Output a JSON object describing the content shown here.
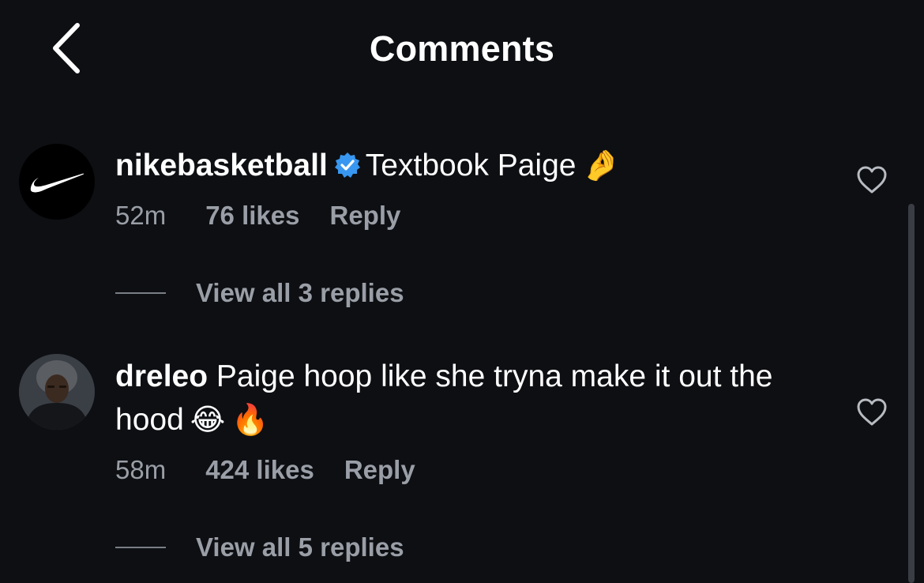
{
  "header": {
    "title": "Comments"
  },
  "comments": [
    {
      "username": "nikebasketball",
      "verified": true,
      "text": "Textbook Paige",
      "emojis": [
        "🤌"
      ],
      "time": "52m",
      "likes": "76 likes",
      "reply": "Reply",
      "view_replies": "View all 3 replies",
      "avatar": "nike-swoosh-logo"
    },
    {
      "username": "dreleo",
      "verified": false,
      "text": "Paige hoop like she tryna make it out the hood",
      "emojis": [
        "😂",
        "🔥"
      ],
      "time": "58m",
      "likes": "424 likes",
      "reply": "Reply",
      "view_replies": "View all 5 replies",
      "avatar": "user-photo"
    }
  ],
  "icons": {
    "back": "chevron-left-icon",
    "like": "heart-outline-icon",
    "verified": "verified-badge-icon"
  },
  "colors": {
    "background": "#0d0f13",
    "primary_text": "#ffffff",
    "secondary_text": "#9a9ea6",
    "verified_blue": "#3897f0"
  }
}
